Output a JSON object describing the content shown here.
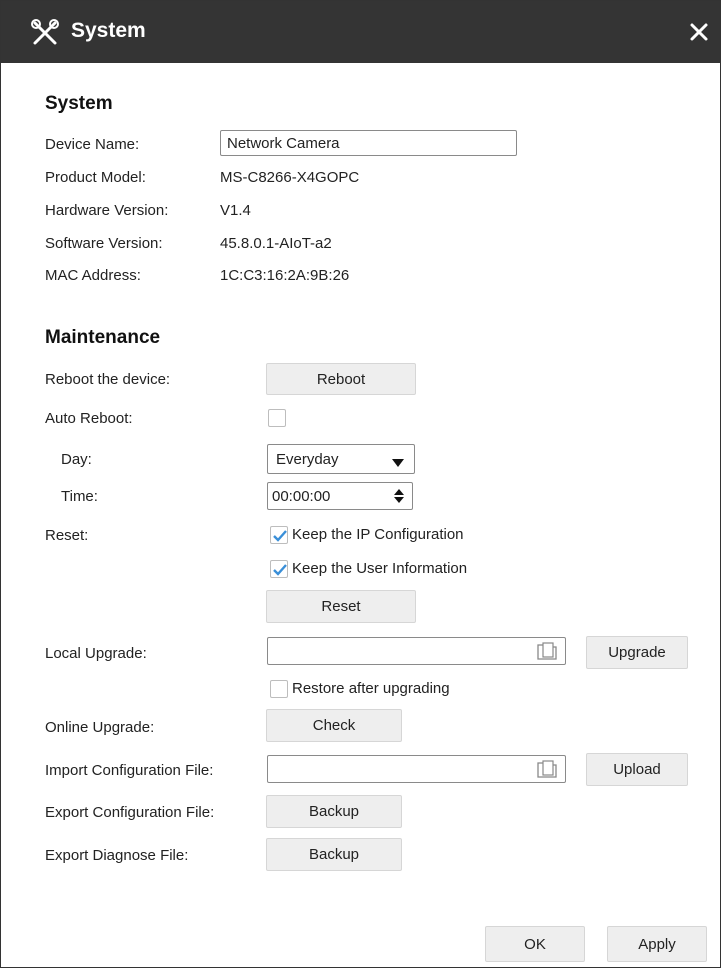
{
  "window": {
    "title": "System",
    "title_icon": "tools-icon",
    "close_icon": "close-icon"
  },
  "system": {
    "heading": "System",
    "device_name_label": "Device Name:",
    "device_name_value": "Network Camera",
    "product_model_label": "Product Model:",
    "product_model_value": "MS-C8266-X4GOPC",
    "hardware_version_label": "Hardware Version:",
    "hardware_version_value": "V1.4",
    "software_version_label": "Software Version:",
    "software_version_value": "45.8.0.1-AIoT-a2",
    "mac_address_label": "MAC Address:",
    "mac_address_value": "1C:C3:16:2A:9B:26"
  },
  "maintenance": {
    "heading": "Maintenance",
    "reboot_label": "Reboot the device:",
    "reboot_button": "Reboot",
    "auto_reboot_label": "Auto Reboot:",
    "auto_reboot_checked": false,
    "day_label": "Day:",
    "day_value": "Everyday",
    "time_label": "Time:",
    "time_value": "00:00:00",
    "reset_label": "Reset:",
    "keep_ip_label": "Keep the IP Configuration",
    "keep_ip_checked": true,
    "keep_user_label": "Keep the User Information",
    "keep_user_checked": true,
    "reset_button": "Reset",
    "local_upgrade_label": "Local Upgrade:",
    "local_upgrade_value": "",
    "upgrade_button": "Upgrade",
    "restore_label": "Restore after upgrading",
    "restore_checked": false,
    "online_upgrade_label": "Online Upgrade:",
    "check_button": "Check",
    "import_config_label": "Import Configuration File:",
    "import_config_value": "",
    "upload_button": "Upload",
    "export_config_label": "Export Configuration File:",
    "export_config_button": "Backup",
    "export_diag_label": "Export Diagnose File:",
    "export_diag_button": "Backup"
  },
  "footer": {
    "ok_button": "OK",
    "apply_button": "Apply"
  },
  "colors": {
    "titlebar": "#343434",
    "check_accent": "#3a8fd8",
    "button_bg": "#eeeeee"
  }
}
